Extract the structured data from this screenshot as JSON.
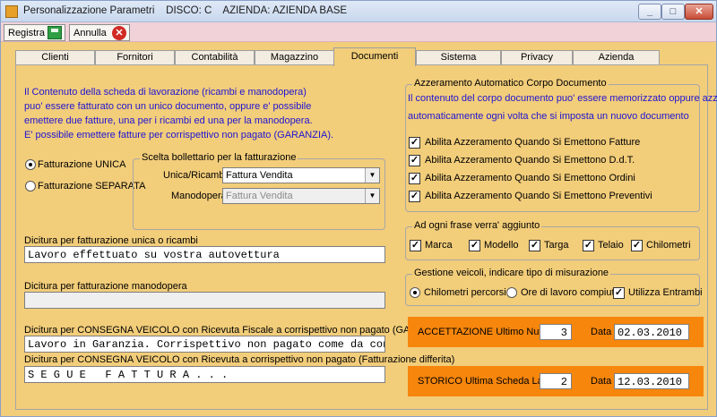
{
  "window": {
    "title": "Personalizzazione Parametri    DISCO: C    AZIENDA: AZIENDA BASE",
    "minimize_glyph": "_",
    "maximize_glyph": "□",
    "close_glyph": "✕"
  },
  "toolbar": {
    "save_label": "Registra",
    "cancel_label": "Annulla",
    "cancel_glyph": "✕"
  },
  "tabs": [
    {
      "label": "Clienti"
    },
    {
      "label": "Fornitori"
    },
    {
      "label": "Contabilità"
    },
    {
      "label": "Magazzino"
    },
    {
      "label": "Documenti",
      "active": true
    },
    {
      "label": "Sistema"
    },
    {
      "label": "Privacy"
    },
    {
      "label": "Azienda"
    }
  ],
  "left": {
    "info_lines": [
      "Il Contenuto della scheda di lavorazione (ricambi e manodopera)",
      "puo' essere fatturato con un unico documento, oppure e' possibile",
      "emettere due fatture, una per i ricambi ed una per la manodopera.",
      "E' possibile emettere fatture per corrispettivo non pagato (GARANZIA)."
    ],
    "radio_unica": {
      "label": "Fatturazione UNICA",
      "selected": true
    },
    "radio_separata": {
      "label": "Fatturazione SEPARATA",
      "selected": false
    },
    "bollettario": {
      "legend": "Scelta bollettario per la fatturazione",
      "unica_label": "Unica/Ricambi",
      "unica_value": "Fattura Vendita",
      "manodopera_label": "Manodopera",
      "manodopera_value": "Fattura Vendita"
    },
    "dicitura_unica_label": "Dicitura per fatturazione unica o ricambi",
    "dicitura_unica_value": "Lavoro effettuato su vostra autovettura",
    "dicitura_manodopera_label": "Dicitura per fatturazione manodopera",
    "dicitura_manodopera_value": "",
    "consegna_garanzia_label": "Dicitura per CONSEGNA VEICOLO con Ricevuta Fiscale a corrispettivo non pagato (GARANZIA)",
    "consegna_garanzia_value": "Lavoro in Garanzia. Corrispettivo non pagato come da convenz",
    "consegna_differita_label": "Dicitura per CONSEGNA VEICOLO con Ricevuta a corrispettivo non pagato (Fatturazione differita)",
    "consegna_differita_value": "S E G U E   F A T T U R A . . ."
  },
  "right": {
    "azzeramento": {
      "legend": "Azzeramento Automatico Corpo Documento",
      "info_lines": [
        "Il contenuto del corpo documento puo' essere memorizzato oppure azzerato",
        "automaticamente ogni volta che si imposta un nuovo documento"
      ],
      "options": [
        {
          "label": "Abilita Azzeramento Quando Si Emettono Fatture",
          "checked": true
        },
        {
          "label": "Abilita Azzeramento Quando Si Emettono D.d.T.",
          "checked": true
        },
        {
          "label": "Abilita Azzeramento Quando Si Emettono Ordini",
          "checked": true
        },
        {
          "label": "Abilita Azzeramento Quando Si Emettono Preventivi",
          "checked": true
        }
      ]
    },
    "frase": {
      "legend": "Ad ogni frase verra' aggiunto",
      "options": [
        {
          "label": "Marca",
          "checked": true
        },
        {
          "label": "Modello",
          "checked": true
        },
        {
          "label": "Targa",
          "checked": true
        },
        {
          "label": "Telaio",
          "checked": true
        },
        {
          "label": "Chilometri",
          "checked": true
        }
      ]
    },
    "gestione": {
      "legend": "Gestione veicoli, indicare tipo di misurazione",
      "radio_km": {
        "label": "Chilometri percorsi",
        "selected": true
      },
      "radio_ore": {
        "label": "Ore di lavoro compiuti",
        "selected": false
      },
      "entrambi": {
        "label": "Utilizza Entrambi",
        "checked": true
      }
    },
    "accettazione": {
      "label": "ACCETTAZIONE Ultimo Numero",
      "number": "3",
      "data_label": "Data",
      "date": "02.03.2010"
    },
    "storico": {
      "label": "STORICO Ultima Scheda Lavoro",
      "number": "2",
      "data_label": "Data",
      "date": "12.03.2010"
    }
  },
  "check_glyph": "✓",
  "dropdown_glyph": "▼"
}
